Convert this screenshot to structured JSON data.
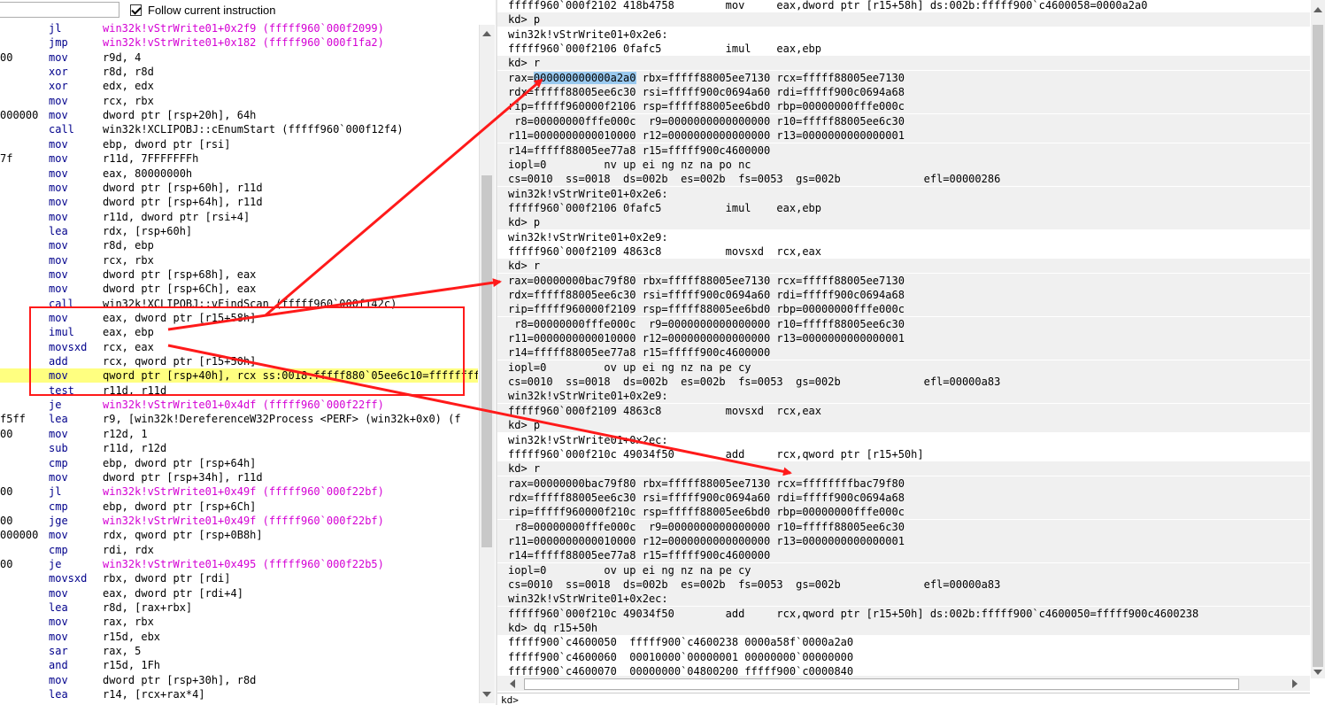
{
  "toolbar": {
    "address_value": "",
    "follow_label": "Follow current instruction",
    "follow_checked": true
  },
  "disasm": [
    {
      "pre": "",
      "mn": "jl",
      "op": "win32k!vStrWrite01+0x2f9 (fffff960`000f2099)",
      "sym": true
    },
    {
      "pre": "",
      "mn": "jmp",
      "op": "win32k!vStrWrite01+0x182 (fffff960`000f1fa2)",
      "sym": true
    },
    {
      "pre": "00",
      "mn": "mov",
      "op": "r9d, 4"
    },
    {
      "pre": "",
      "mn": "xor",
      "op": "r8d, r8d"
    },
    {
      "pre": "",
      "mn": "xor",
      "op": "edx, edx"
    },
    {
      "pre": "",
      "mn": "mov",
      "op": "rcx, rbx"
    },
    {
      "pre": "000000",
      "mn": "mov",
      "op": "dword ptr [rsp+20h], 64h"
    },
    {
      "pre": "",
      "mn": "call",
      "op": "win32k!XCLIPOBJ::cEnumStart (fffff960`000f12f4)"
    },
    {
      "pre": "",
      "mn": "mov",
      "op": "ebp, dword ptr [rsi]"
    },
    {
      "pre": "7f",
      "mn": "mov",
      "op": "r11d, 7FFFFFFFh"
    },
    {
      "pre": "",
      "mn": "mov",
      "op": "eax, 80000000h"
    },
    {
      "pre": "",
      "mn": "mov",
      "op": "dword ptr [rsp+60h], r11d"
    },
    {
      "pre": "",
      "mn": "mov",
      "op": "dword ptr [rsp+64h], r11d"
    },
    {
      "pre": "",
      "mn": "mov",
      "op": "r11d, dword ptr [rsi+4]"
    },
    {
      "pre": "",
      "mn": "lea",
      "op": "rdx, [rsp+60h]"
    },
    {
      "pre": "",
      "mn": "mov",
      "op": "r8d, ebp"
    },
    {
      "pre": "",
      "mn": "mov",
      "op": "rcx, rbx"
    },
    {
      "pre": "",
      "mn": "mov",
      "op": "dword ptr [rsp+68h], eax"
    },
    {
      "pre": "",
      "mn": "mov",
      "op": "dword ptr [rsp+6Ch], eax"
    },
    {
      "pre": "",
      "mn": "call",
      "op": "win32k!XCLIPOBJ::vFindScan (fffff960`000f142c)"
    },
    {
      "pre": "",
      "mn": "mov",
      "op": "eax, dword ptr [r15+58h]"
    },
    {
      "pre": "",
      "mn": "imul",
      "op": "eax, ebp"
    },
    {
      "pre": "",
      "mn": "movsxd",
      "op": "rcx, eax"
    },
    {
      "pre": "",
      "mn": "add",
      "op": "rcx, qword ptr [r15+50h]"
    },
    {
      "pre": "",
      "mn": "mov",
      "op": "qword ptr [rsp+40h], rcx ss:0018:fffff880`05ee6c10=ffffffff",
      "cur": true
    },
    {
      "pre": "",
      "mn": "test",
      "op": "r11d, r11d"
    },
    {
      "pre": "",
      "mn": "je",
      "op": "win32k!vStrWrite01+0x4df (fffff960`000f22ff)",
      "sym": true
    },
    {
      "pre": "f5ff",
      "mn": "lea",
      "op": "r9, [win32k!DereferenceW32Process <PERF> (win32k+0x0) (f"
    },
    {
      "pre": "00",
      "mn": "mov",
      "op": "r12d, 1"
    },
    {
      "pre": "",
      "mn": "sub",
      "op": "r11d, r12d"
    },
    {
      "pre": "",
      "mn": "cmp",
      "op": "ebp, dword ptr [rsp+64h]"
    },
    {
      "pre": "",
      "mn": "mov",
      "op": "dword ptr [rsp+34h], r11d"
    },
    {
      "pre": "00",
      "mn": "jl",
      "op": "win32k!vStrWrite01+0x49f (fffff960`000f22bf)",
      "sym": true
    },
    {
      "pre": "",
      "mn": "cmp",
      "op": "ebp, dword ptr [rsp+6Ch]"
    },
    {
      "pre": "00",
      "mn": "jge",
      "op": "win32k!vStrWrite01+0x49f (fffff960`000f22bf)",
      "sym": true
    },
    {
      "pre": "000000",
      "mn": "mov",
      "op": "rdx, qword ptr [rsp+0B8h]"
    },
    {
      "pre": "",
      "mn": "cmp",
      "op": "rdi, rdx"
    },
    {
      "pre": "00",
      "mn": "je",
      "op": "win32k!vStrWrite01+0x495 (fffff960`000f22b5)",
      "sym": true
    },
    {
      "pre": "",
      "mn": "movsxd",
      "op": "rbx, dword ptr [rdi]"
    },
    {
      "pre": "",
      "mn": "mov",
      "op": "eax, dword ptr [rdi+4]"
    },
    {
      "pre": "",
      "mn": "lea",
      "op": "r8d, [rax+rbx]"
    },
    {
      "pre": "",
      "mn": "mov",
      "op": "rax, rbx"
    },
    {
      "pre": "",
      "mn": "mov",
      "op": "r15d, ebx"
    },
    {
      "pre": "",
      "mn": "sar",
      "op": "rax, 5"
    },
    {
      "pre": "",
      "mn": "and",
      "op": "r15d, 1Fh"
    },
    {
      "pre": "",
      "mn": "mov",
      "op": "dword ptr [rsp+30h], r8d"
    },
    {
      "pre": "",
      "mn": "lea",
      "op": "r14, [rcx+rax*4]"
    }
  ],
  "cmd": [
    {
      "t": "fffff960`000f2102 418b4758        mov     eax,dword ptr [r15+58h] ds:002b:fffff900`c4600058=0000a2a0"
    },
    {
      "t": "kd> p",
      "band": true
    },
    {
      "t": "win32k!vStrWrite01+0x2e6:"
    },
    {
      "t": "fffff960`000f2106 0fafc5          imul    eax,ebp"
    },
    {
      "t": "kd> r",
      "band": true
    },
    {
      "t": "rax=",
      "sel": "000000000000a2a0",
      "rest": " rbx=fffff88005ee7130 rcx=fffff88005ee7130",
      "band": true
    },
    {
      "t": "rdx=fffff88005ee6c30 rsi=fffff900c0694a60 rdi=fffff900c0694a68",
      "band": true
    },
    {
      "t": "rip=fffff960000f2106 rsp=fffff88005ee6bd0 rbp=00000000fffe000c",
      "band": true
    },
    {
      "t": " r8=00000000fffe000c  r9=0000000000000000 r10=fffff88005ee6c30",
      "band": true
    },
    {
      "t": "r11=0000000000010000 r12=0000000000000000 r13=0000000000000001",
      "band": true
    },
    {
      "t": "r14=fffff88005ee77a8 r15=fffff900c4600000",
      "band": true
    },
    {
      "t": "iopl=0         nv up ei ng nz na po nc",
      "band": true
    },
    {
      "t": "cs=0010  ss=0018  ds=002b  es=002b  fs=0053  gs=002b             efl=00000286",
      "band": true
    },
    {
      "t": "win32k!vStrWrite01+0x2e6:",
      "band": true
    },
    {
      "t": "fffff960`000f2106 0fafc5          imul    eax,ebp",
      "band": true
    },
    {
      "t": "kd> p",
      "band": true
    },
    {
      "t": "win32k!vStrWrite01+0x2e9:"
    },
    {
      "t": "fffff960`000f2109 4863c8          movsxd  rcx,eax"
    },
    {
      "t": "kd> r",
      "band": true
    },
    {
      "t": "rax=00000000bac79f80 rbx=fffff88005ee7130 rcx=fffff88005ee7130",
      "band": true
    },
    {
      "t": "rdx=fffff88005ee6c30 rsi=fffff900c0694a60 rdi=fffff900c0694a68",
      "band": true
    },
    {
      "t": "rip=fffff960000f2109 rsp=fffff88005ee6bd0 rbp=00000000fffe000c",
      "band": true
    },
    {
      "t": " r8=00000000fffe000c  r9=0000000000000000 r10=fffff88005ee6c30",
      "band": true
    },
    {
      "t": "r11=0000000000010000 r12=0000000000000000 r13=0000000000000001",
      "band": true
    },
    {
      "t": "r14=fffff88005ee77a8 r15=fffff900c4600000",
      "band": true
    },
    {
      "t": "iopl=0         ov up ei ng nz na pe cy",
      "band": true
    },
    {
      "t": "cs=0010  ss=0018  ds=002b  es=002b  fs=0053  gs=002b             efl=00000a83",
      "band": true
    },
    {
      "t": "win32k!vStrWrite01+0x2e9:",
      "band": true
    },
    {
      "t": "fffff960`000f2109 4863c8          movsxd  rcx,eax",
      "band": true
    },
    {
      "t": "kd> p",
      "band": true
    },
    {
      "t": "win32k!vStrWrite01+0x2ec:"
    },
    {
      "t": "fffff960`000f210c 49034f50        add     rcx,qword ptr [r15+50h]"
    },
    {
      "t": "kd> r",
      "band": true
    },
    {
      "t": "rax=00000000bac79f80 rbx=fffff88005ee7130 rcx=ffffffffbac79f80",
      "band": true
    },
    {
      "t": "rdx=fffff88005ee6c30 rsi=fffff900c0694a60 rdi=fffff900c0694a68",
      "band": true
    },
    {
      "t": "rip=fffff960000f210c rsp=fffff88005ee6bd0 rbp=00000000fffe000c",
      "band": true
    },
    {
      "t": " r8=00000000fffe000c  r9=0000000000000000 r10=fffff88005ee6c30",
      "band": true
    },
    {
      "t": "r11=0000000000010000 r12=0000000000000000 r13=0000000000000001",
      "band": true
    },
    {
      "t": "r14=fffff88005ee77a8 r15=fffff900c4600000",
      "band": true
    },
    {
      "t": "iopl=0         ov up ei ng nz na pe cy",
      "band": true
    },
    {
      "t": "cs=0010  ss=0018  ds=002b  es=002b  fs=0053  gs=002b             efl=00000a83",
      "band": true
    },
    {
      "t": "win32k!vStrWrite01+0x2ec:",
      "band": true
    },
    {
      "t": "fffff960`000f210c 49034f50        add     rcx,qword ptr [r15+50h] ds:002b:fffff900`c4600050=fffff900c4600238",
      "band": true
    },
    {
      "t": "kd> dq r15+50h",
      "band": true
    },
    {
      "t": "fffff900`c4600050  fffff900`c4600238 0000a58f`0000a2a0"
    },
    {
      "t": "fffff900`c4600060  00010000`00000001 00000000`00000000"
    },
    {
      "t": "fffff900`c4600070  00000000`04800200 fffff900`c0000840"
    }
  ],
  "cmd_input": {
    "prompt": "kd>"
  },
  "colors": {
    "annotation": "#ff1a1a",
    "current_line": "#ffff80",
    "symbol": "#d400d4",
    "mnemonic": "#00008b"
  }
}
